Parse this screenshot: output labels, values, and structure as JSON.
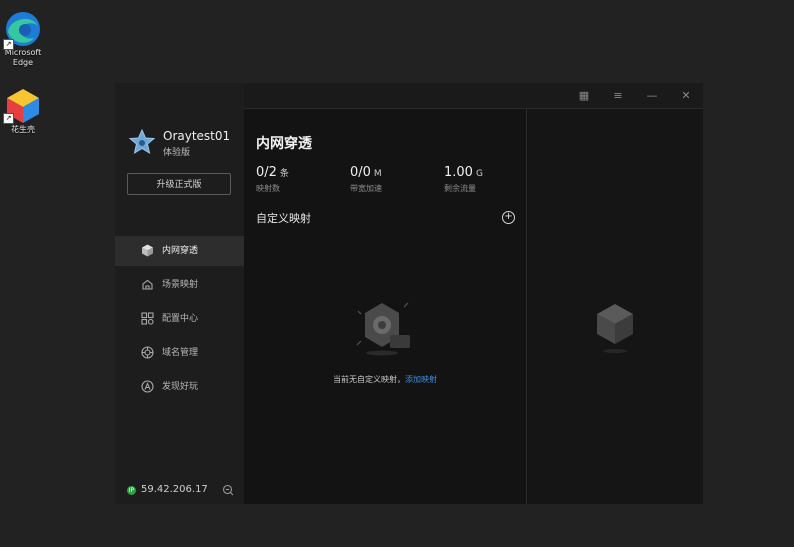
{
  "desktop": {
    "icons": [
      {
        "label_line1": "Microsoft",
        "label_line2": "Edge"
      },
      {
        "label_line1": "花生壳",
        "label_line2": ""
      }
    ]
  },
  "profile": {
    "username": "Oraytest01",
    "edition": "体验版",
    "upgrade_label": "升级正式版"
  },
  "nav": {
    "items": [
      {
        "label": "内网穿透",
        "icon": "cube-icon",
        "active": true
      },
      {
        "label": "场景映射",
        "icon": "scene-map-icon",
        "active": false
      },
      {
        "label": "配置中心",
        "icon": "config-grid-icon",
        "active": false
      },
      {
        "label": "域名管理",
        "icon": "domain-icon",
        "active": false
      },
      {
        "label": "发现好玩",
        "icon": "discover-icon",
        "active": false
      }
    ]
  },
  "status": {
    "ip": "59.42.206.17",
    "ip_badge": "IP"
  },
  "main": {
    "title": "内网穿透",
    "stats": [
      {
        "value": "0/2",
        "unit": "条",
        "caption": "映射数"
      },
      {
        "value": "0/0",
        "unit": "M",
        "caption": "带宽加速"
      },
      {
        "value": "1.00",
        "unit": "G",
        "caption": "剩余流量"
      }
    ],
    "section_title": "自定义映射",
    "add_symbol": "+",
    "empty_text": "当前无自定义映射，",
    "empty_link": "添加映射"
  },
  "window_controls": {
    "qr_symbol": "▦",
    "menu_symbol": "≡",
    "minimize_symbol": "—",
    "close_symbol": "✕"
  },
  "colors": {
    "accent_link": "#3b8de5",
    "active_nav_bg": "#2d2d2d",
    "ip_status": "#2ea043"
  }
}
